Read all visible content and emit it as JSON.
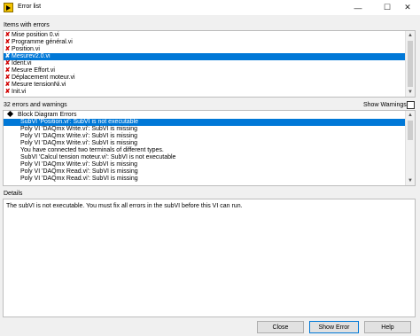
{
  "window": {
    "title": "Error list"
  },
  "titlebar_buttons": {
    "minimize": "—",
    "maximize": "☐",
    "close": "✕"
  },
  "items_section": {
    "label": "Items with errors"
  },
  "items": [
    {
      "label": "Mise position 0.vi",
      "selected": false
    },
    {
      "label": "Programme général.vi",
      "selected": false
    },
    {
      "label": "Position.vi",
      "selected": false
    },
    {
      "label": "Mesurev2.0.vi",
      "selected": true
    },
    {
      "label": "Ident.vi",
      "selected": false
    },
    {
      "label": "Mesure Effort.vi",
      "selected": false
    },
    {
      "label": "Déplacement moteur.vi",
      "selected": false
    },
    {
      "label": "Mesure tensionNi.vi",
      "selected": false
    },
    {
      "label": "Init.vi",
      "selected": false
    }
  ],
  "errors_section": {
    "count_label": "32 errors and warnings",
    "show_warnings_label": "Show Warnings",
    "show_warnings_checked": false
  },
  "tree": {
    "group": "Block Diagram Errors",
    "children": [
      {
        "text": "SubVI 'Position.vi': SubVI is not executable",
        "selected": true
      },
      {
        "text": "Poly VI 'DAQmx Write.vi': SubVI is missing",
        "selected": false
      },
      {
        "text": "Poly VI 'DAQmx Write.vi': SubVI is missing",
        "selected": false
      },
      {
        "text": "Poly VI 'DAQmx Write.vi': SubVI is missing",
        "selected": false
      },
      {
        "text": "You have connected two terminals of different types.",
        "selected": false
      },
      {
        "text": "SubVI 'Calcul tension moteur.vi': SubVI is not executable",
        "selected": false
      },
      {
        "text": "Poly VI 'DAQmx Write.vi': SubVI is missing",
        "selected": false
      },
      {
        "text": "Poly VI 'DAQmx Read.vi': SubVI is missing",
        "selected": false
      },
      {
        "text": "Poly VI 'DAQmx Read.vi': SubVI is missing",
        "selected": false
      }
    ]
  },
  "details": {
    "label": "Details",
    "text": "The subVI is not executable. You must fix all errors in the subVI before this VI can run."
  },
  "buttons": {
    "close": "Close",
    "show_error": "Show Error",
    "help": "Help"
  }
}
